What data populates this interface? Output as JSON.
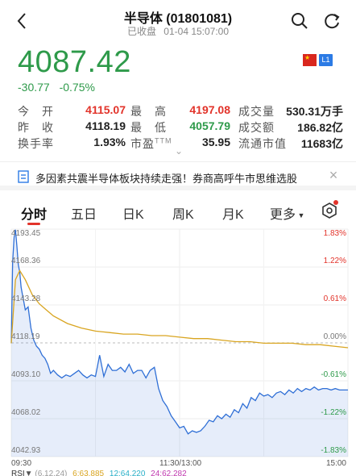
{
  "header": {
    "title": "半导体 (01801081)",
    "status": "已收盘",
    "timestamp": "01-04 15:07:00"
  },
  "quote": {
    "price": "4087.42",
    "change": "-30.77",
    "change_pct": "-0.75%",
    "market_badge": "L1"
  },
  "stats": {
    "open_label": "今　开",
    "open": "4115.07",
    "high_label": "最　高",
    "high": "4197.08",
    "volume_label": "成交量",
    "volume": "530.31万手",
    "prev_close_label": "昨　收",
    "prev_close": "4118.19",
    "low_label": "最　低",
    "low": "4057.79",
    "amount_label": "成交额",
    "amount": "186.82亿",
    "turnover_label": "换手率",
    "turnover": "1.93%",
    "pe_label": "市盈",
    "pe_suffix": "TTM",
    "pe": "35.95",
    "float_cap_label": "流通市值",
    "float_cap": "11683亿"
  },
  "news": {
    "text": "多因素共震半导体板块持续走强！券商高呼牛市思维选股"
  },
  "tabs": [
    {
      "label": "分时"
    },
    {
      "label": "五日"
    },
    {
      "label": "日K"
    },
    {
      "label": "周K"
    },
    {
      "label": "月K"
    },
    {
      "label": "更多"
    }
  ],
  "colors": {
    "up": "#e2332a",
    "down": "#2e9a4a",
    "price_line": "#2f6fd6",
    "avg_line": "#d9a520"
  },
  "chart_data": {
    "type": "line",
    "y_ticks": [
      "4193.45",
      "4168.36",
      "4143.28",
      "4118.19",
      "4093.10",
      "4068.02",
      "4042.93"
    ],
    "pct_ticks": [
      "1.83%",
      "1.22%",
      "0.61%",
      "0.00%",
      "-0.61%",
      "-1.22%",
      "-1.83%"
    ],
    "x_ticks": [
      "09:30",
      "11:30/13:00",
      "15:00"
    ],
    "ylim": [
      4042.93,
      4193.45
    ],
    "prev_close": 4118.19,
    "grid": true,
    "series": [
      {
        "x": [
          0,
          1,
          2,
          3,
          4,
          5,
          6,
          7,
          8,
          9,
          10,
          12,
          14,
          16,
          18,
          20,
          22,
          24,
          26,
          28,
          30,
          33,
          36,
          39,
          42,
          45,
          48,
          51,
          54,
          57,
          60,
          63,
          66,
          69,
          72,
          75,
          78,
          81,
          84,
          87,
          90,
          93,
          96,
          99,
          102,
          105,
          108,
          111,
          114,
          117,
          120,
          123,
          126,
          129,
          132,
          135,
          138,
          141,
          144,
          147,
          150,
          153,
          156,
          159,
          162,
          165,
          168,
          171,
          174,
          177,
          180,
          183,
          186,
          189,
          192,
          195,
          198,
          201,
          204,
          207,
          210,
          213,
          216,
          219,
          222,
          225,
          228,
          231,
          234,
          237,
          240
        ],
        "values": [
          4118,
          4172,
          4188,
          4193,
          4182,
          4170,
          4165,
          4155,
          4150,
          4145,
          4140,
          4142,
          4128,
          4120,
          4116,
          4114,
          4110,
          4108,
          4104,
          4098,
          4100,
          4097,
          4095,
          4097,
          4096,
          4098,
          4100,
          4097,
          4095,
          4097,
          4096,
          4110,
          4096,
          4104,
          4100,
          4100,
          4102,
          4099,
          4104,
          4098,
          4100,
          4100,
          4095,
          4100,
          4102,
          4088,
          4080,
          4076,
          4070,
          4066,
          4062,
          4063,
          4058,
          4060,
          4059,
          4060,
          4063,
          4067,
          4066,
          4070,
          4068,
          4071,
          4069,
          4074,
          4072,
          4078,
          4075,
          4082,
          4080,
          4085,
          4083,
          4084,
          4082,
          4085,
          4086,
          4084,
          4087,
          4085,
          4088,
          4086,
          4088,
          4087,
          4089,
          4087,
          4088,
          4088,
          4087,
          4088,
          4087,
          4087,
          4087
        ]
      },
      {
        "x": [
          0,
          3,
          6,
          10,
          15,
          20,
          25,
          30,
          40,
          50,
          60,
          70,
          80,
          90,
          100,
          110,
          120,
          130,
          140,
          150,
          160,
          170,
          180,
          190,
          200,
          210,
          220,
          230,
          240
        ],
        "values": [
          4118,
          4160,
          4166,
          4160,
          4150,
          4144,
          4140,
          4136,
          4131,
          4128,
          4126,
          4125,
          4124,
          4124,
          4123,
          4123,
          4122,
          4121,
          4121,
          4120,
          4119,
          4119,
          4118,
          4118,
          4118,
          4117,
          4117,
          4116,
          4115
        ]
      }
    ]
  },
  "rsi": {
    "label": "RSI",
    "params": "(6,12,24)",
    "rsi6": "6:63.885",
    "rsi12": "12:64.220",
    "rsi24": "24:62.282"
  }
}
